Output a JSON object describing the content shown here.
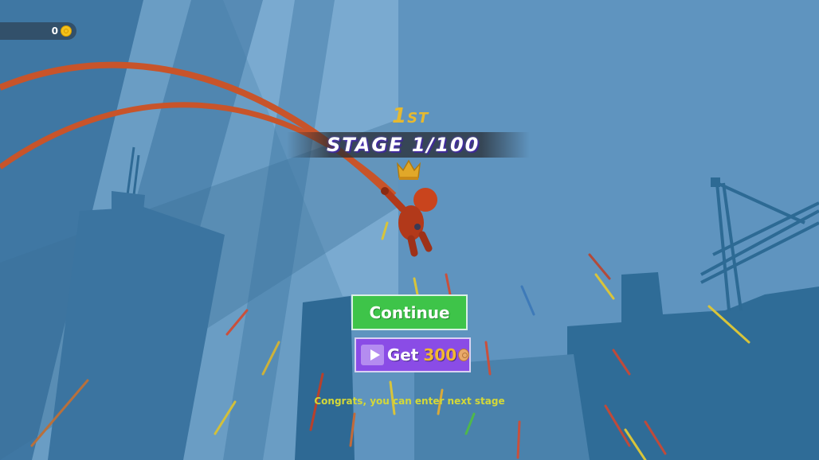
{
  "hud": {
    "coin_count": "0",
    "coin_icon": "coin-icon"
  },
  "result": {
    "rank_number": "1",
    "rank_suffix": "ST",
    "stage_label": "STAGE 1/100",
    "crown_icon": "crown-icon"
  },
  "buttons": {
    "continue_label": "Continue",
    "get_label": "Get",
    "get_amount": "300",
    "video_icon": "video-icon",
    "reward_coin_icon": "coin-icon"
  },
  "message": "Congrats, you can enter next stage",
  "colors": {
    "sky": "#5f94bf",
    "continue_bg": "#3ec449",
    "get_bg": "#8a4ce6",
    "rank_gold": "#e6b930",
    "web_rope": "#c8542a",
    "congrats_text": "#d4d838"
  }
}
